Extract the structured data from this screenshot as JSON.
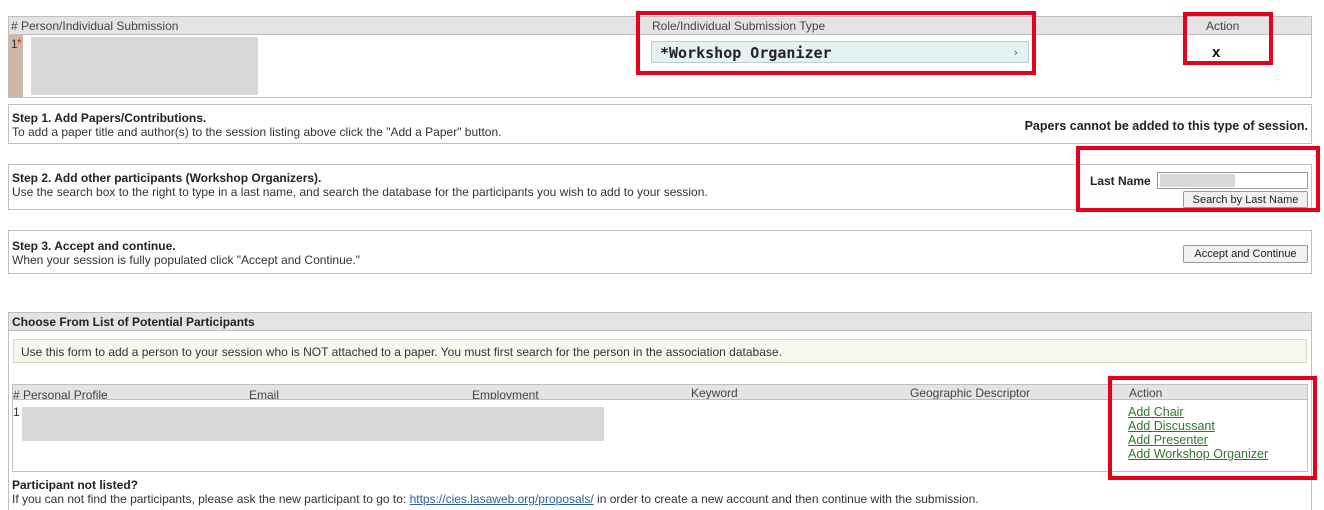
{
  "submission_table": {
    "col_person": "# Person/Individual Submission",
    "col_role": "Role/Individual Submission Type",
    "col_action": "Action",
    "row_number": "1",
    "required_mark": "*",
    "role_value": "*Workshop Organizer",
    "remove_label": "x"
  },
  "step1": {
    "title": "Step 1. Add Papers/Contributions.",
    "desc": "To add a paper title and author(s) to the session listing above click the \"Add a Paper\" button.",
    "notice": "Papers cannot be added to this type of session."
  },
  "step2": {
    "title": "Step 2. Add other participants (Workshop Organizers).",
    "desc": "Use the search box to the right to type in a last name, and search the database for the participants you wish to add to your session.",
    "last_name_label": "Last Name",
    "search_button": "Search by Last Name"
  },
  "step3": {
    "title": "Step 3. Accept and continue.",
    "desc": "When your session is fully populated click \"Accept and Continue.\"",
    "accept_button": "Accept and Continue"
  },
  "participants": {
    "title": "Choose From List of Potential Participants",
    "info": "Use this form to add a person to your session who is NOT attached to a paper. You must first search for the person in the association database.",
    "columns": {
      "profile": "# Personal Profile",
      "email": "Email",
      "employment": "Employment",
      "keyword": "Keyword",
      "geo": "Geographic Descriptor",
      "action": "Action"
    },
    "row_number": "1",
    "actions": [
      "Add Chair",
      "Add Discussant",
      "Add Presenter",
      "Add Workshop Organizer"
    ]
  },
  "not_listed": {
    "title": "Participant not listed?",
    "desc_before": "If you can not find the participants, please ask the new participant to go to: ",
    "link": "https://cies.lasaweb.org/proposals/",
    "desc_after": " in order to create a new account and then continue with the submission."
  }
}
